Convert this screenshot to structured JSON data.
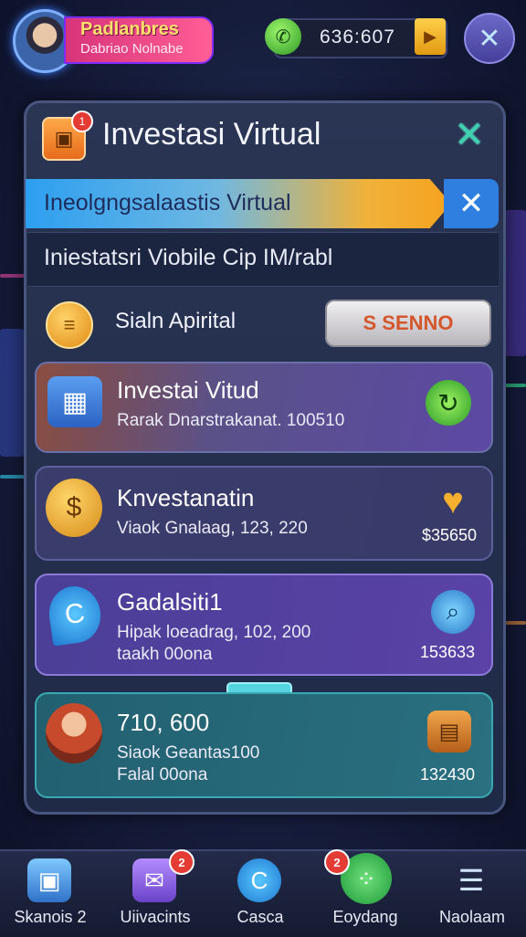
{
  "header": {
    "player_name": "Padlanbres",
    "player_sub": "Dabriao Nolnabe",
    "coins": "636:607",
    "coin_icon": "phone-coin-icon",
    "add_icon": "plus-icon",
    "close_icon": "close-icon"
  },
  "panel": {
    "title": "Investasi Virtual",
    "badge": "1",
    "banner_text": "Ineolgngsalaastis Virtual",
    "subtitle": "Iniestatsri Viobile Cip IM/rabl",
    "capital_label": "Sialn Apirital",
    "send_button": "S SENNO"
  },
  "cards": [
    {
      "title": "Investai Vitud",
      "line1": "Rarak Dnarstrakanat. 100510",
      "line2": "",
      "amount": ""
    },
    {
      "title": "Knvestanatin",
      "line1": "Viaok Gnalaag, 123, 220",
      "line2": "",
      "amount": "$35650"
    },
    {
      "title": "Gadalsiti1",
      "line1": "Hipak loeadrag, 102, 200",
      "line2": "taakh 00ona",
      "amount": "153633"
    },
    {
      "title": "710, 600",
      "line1": "Siaok Geantas100",
      "line2": "Falal 00ona",
      "amount": "132430"
    }
  ],
  "nav": [
    {
      "label": "Skanois 2",
      "icon": "box-icon",
      "badge": ""
    },
    {
      "label": "Uiivacints",
      "icon": "chat-icon",
      "badge": "2"
    },
    {
      "label": "Casca",
      "icon": "phone-bubble-icon",
      "badge": ""
    },
    {
      "label": "Eoydang",
      "icon": "dice-icon",
      "badge": "2"
    },
    {
      "label": "Naolaam",
      "icon": "menu-icon",
      "badge": ""
    }
  ]
}
